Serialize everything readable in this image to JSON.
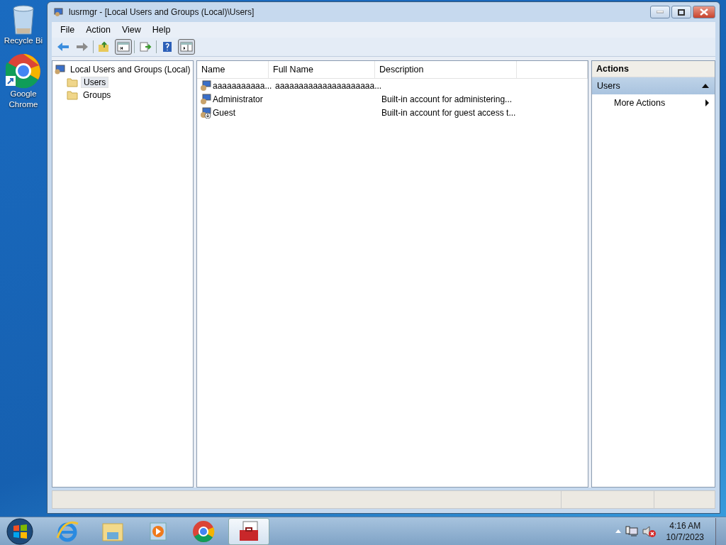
{
  "desktop_icons": [
    {
      "kind": "recycle",
      "label": "Recycle Bi"
    },
    {
      "kind": "chrome",
      "label": "Google Chrome"
    }
  ],
  "window": {
    "title": "lusrmgr - [Local Users and Groups (Local)\\Users]"
  },
  "menu": [
    "File",
    "Action",
    "View",
    "Help"
  ],
  "toolbar": [
    {
      "kind": "back",
      "pressed": false
    },
    {
      "kind": "forward",
      "pressed": false
    },
    {
      "kind": "sep"
    },
    {
      "kind": "up",
      "pressed": false
    },
    {
      "kind": "tree",
      "pressed": true
    },
    {
      "kind": "sep"
    },
    {
      "kind": "export",
      "pressed": false
    },
    {
      "kind": "sep"
    },
    {
      "kind": "help",
      "pressed": false
    },
    {
      "kind": "pane",
      "pressed": true
    }
  ],
  "tree": {
    "label": "Local Users and Groups (Local)",
    "children": [
      {
        "label": "Users",
        "selected": true
      },
      {
        "label": "Groups",
        "selected": false
      }
    ]
  },
  "table": {
    "columns": [
      "Name",
      "Full Name",
      "Description"
    ],
    "rows": [
      {
        "name": "aaaaaaaaaaa...",
        "full_name": "aaaaaaaaaaaaaaaaaaaaa...",
        "description": "",
        "disabled": false
      },
      {
        "name": "Administrator",
        "full_name": "",
        "description": "Built-in account for administering...",
        "disabled": false
      },
      {
        "name": "Guest",
        "full_name": "",
        "description": "Built-in account for guest access t...",
        "disabled": true
      }
    ]
  },
  "actions": {
    "title": "Actions",
    "section": {
      "label": "Users",
      "expanded": true
    },
    "items": [
      {
        "label": "More Actions",
        "submenu": true
      }
    ]
  },
  "taskbar": {
    "items": [
      {
        "kind": "ie",
        "selected": false
      },
      {
        "kind": "explorer",
        "selected": false
      },
      {
        "kind": "media",
        "selected": false
      },
      {
        "kind": "chrome",
        "selected": false
      },
      {
        "kind": "toolbox",
        "selected": true
      }
    ],
    "time": "4:16 AM",
    "date": "10/7/2023"
  }
}
